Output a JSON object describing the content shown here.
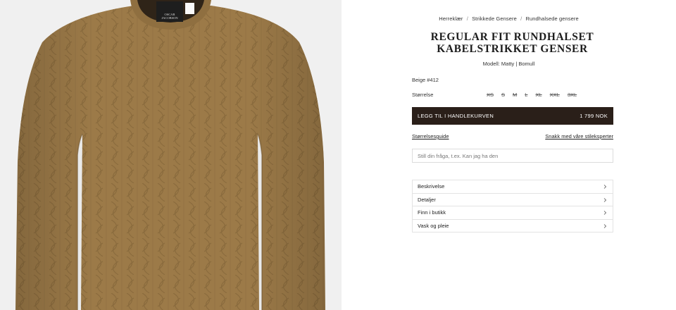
{
  "breadcrumb": {
    "items": [
      "Herreklær",
      "Strikkede Gensere",
      "Rundhalsede gensere"
    ],
    "separator": "/"
  },
  "product": {
    "title": "REGULAR FIT RUNDHALSET KABELSTRIKKET GENSER",
    "model": "Modell: Matty | Bomull",
    "color": "Beige #412",
    "image_color": "#9c7a48"
  },
  "size_selector": {
    "label": "Størrelse",
    "sizes": [
      "XS",
      "S",
      "M",
      "L",
      "XL",
      "XXL",
      "3XL"
    ]
  },
  "cart": {
    "label": "LEGG TIL I HANDLEKURVEN",
    "price": "1 799 NOK",
    "bg_color": "#2a1f19"
  },
  "links": {
    "size_guide": "Størrelsesguide",
    "style_expert": "Snakk med våre stileksperter"
  },
  "question": {
    "placeholder": "Still din fråga, t.ex. Kan jag ha den"
  },
  "accordion": {
    "items": [
      "Beskrivelse",
      "Detaljer",
      "Finn i butikk",
      "Vask og pleie"
    ]
  },
  "label_tag": {
    "brand_line1": "OSCAR",
    "brand_line2": "JACOBSON"
  }
}
